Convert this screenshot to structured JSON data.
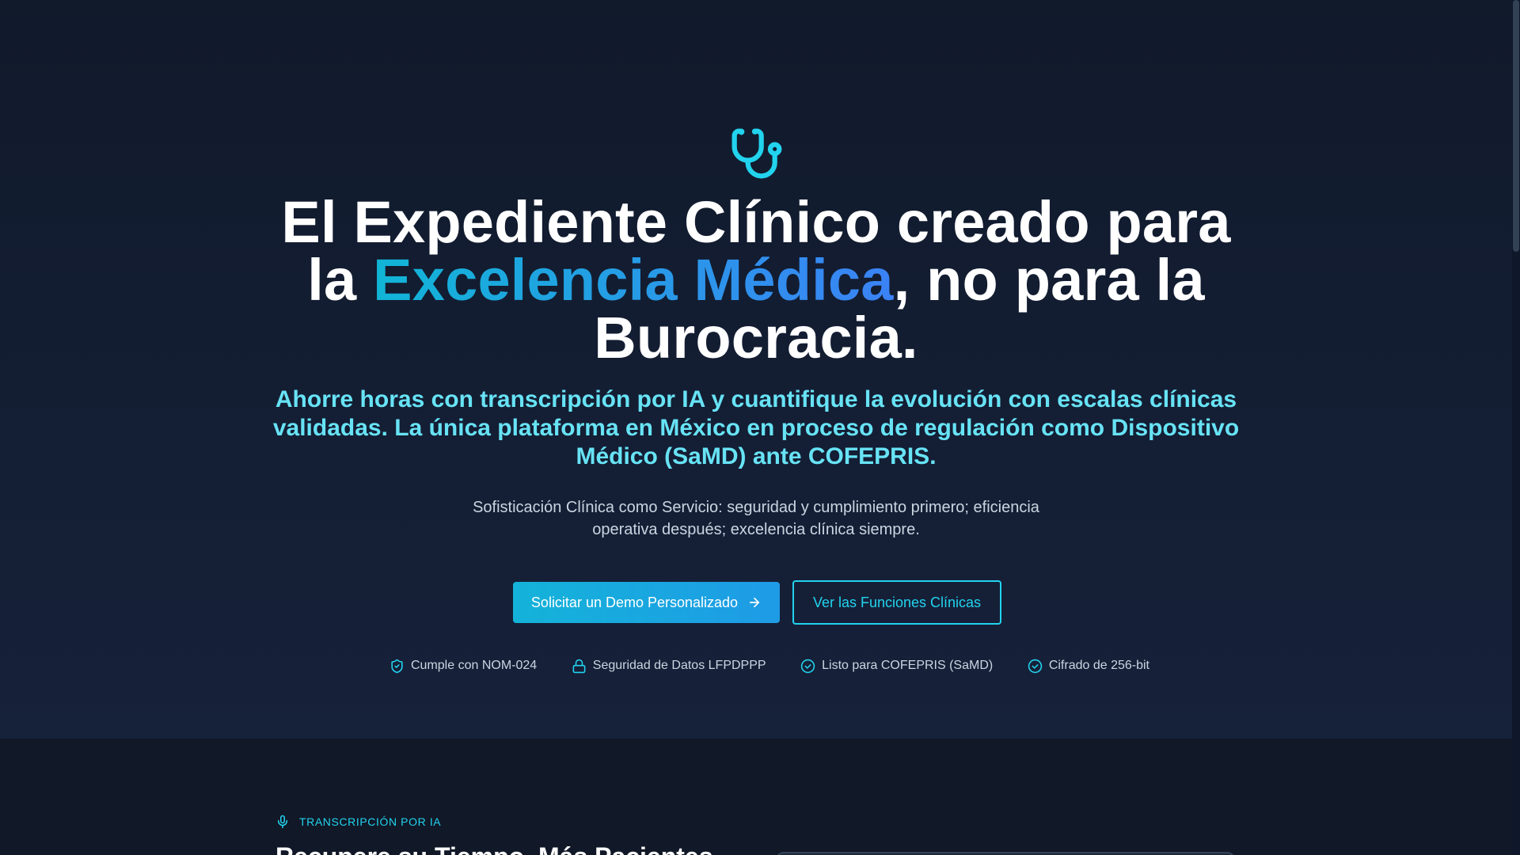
{
  "hero": {
    "logo_icon": "stethoscope-icon",
    "headline_before": "El Expediente Clínico creado para la ",
    "headline_accent": "Excelencia Médica",
    "headline_after": ", no para la Burocracia.",
    "subheadline": "Ahorre horas con transcripción por IA y cuantifique la evolución con escalas clínicas validadas. La única plataforma en México en proceso de regulación como Dispositivo Médico (SaMD) ante COFEPRIS.",
    "tagline": "Sofisticación Clínica como Servicio: seguridad y cumplimiento primero; eficiencia operativa después; excelencia clínica siempre.",
    "cta_primary": "Solicitar un Demo Personalizado",
    "cta_primary_icon": "arrow-right-icon",
    "cta_secondary": "Ver las Funciones Clínicas",
    "badges": [
      {
        "icon": "shield-check-icon",
        "label": "Cumple con NOM-024"
      },
      {
        "icon": "lock-icon",
        "label": "Seguridad de Datos LFPDPPP"
      },
      {
        "icon": "check-circle-icon",
        "label": "Listo para COFEPRIS (SaMD)"
      },
      {
        "icon": "check-circle-icon",
        "label": "Cifrado de 256-bit"
      }
    ]
  },
  "feature": {
    "eyebrow_icon": "microphone-icon",
    "eyebrow": "TRANSCRIPCIÓN POR IA",
    "title": "Recupere su Tiempo, Más Pacientes"
  },
  "colors": {
    "background": "#111827",
    "accent_cyan": "#22d3ee",
    "accent_blue": "#3b82f6",
    "subheadline": "#67e3f5",
    "text_muted": "#cbd5e1"
  }
}
